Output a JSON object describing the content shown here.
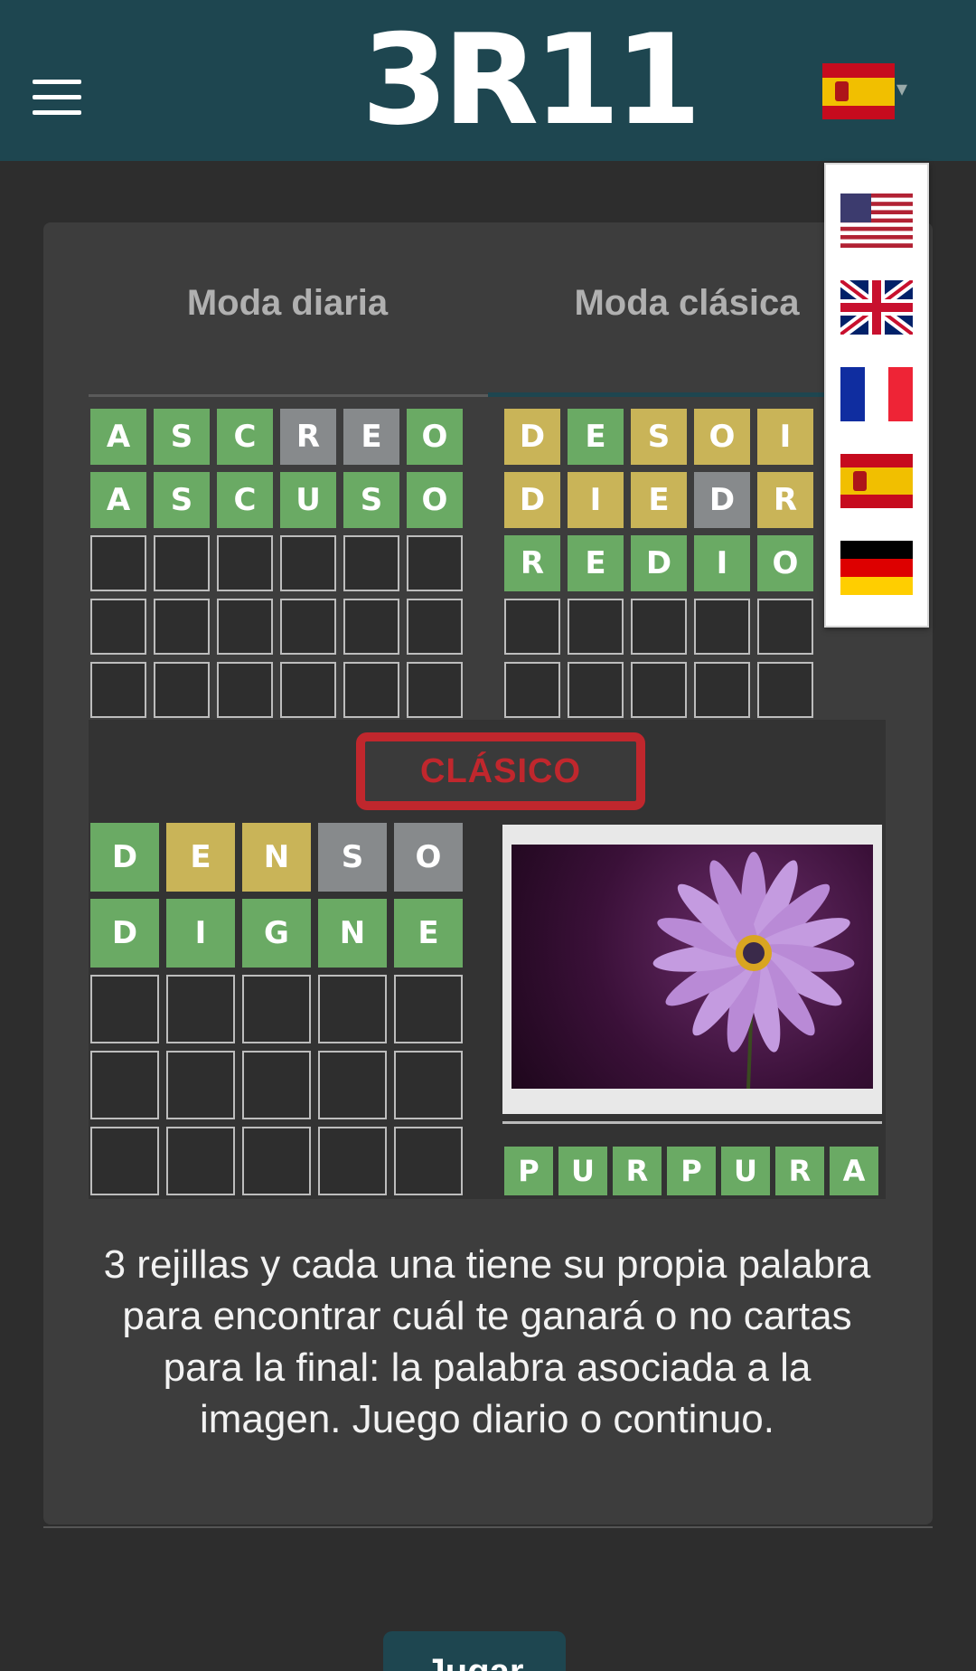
{
  "header": {
    "logo": "3R11",
    "current_language": "es",
    "colors": {
      "header_bg": "#1e4650"
    }
  },
  "tabs": [
    {
      "label": "Moda diaria",
      "active": false
    },
    {
      "label": "Moda clásica",
      "active": true
    }
  ],
  "preview": {
    "grid1_rows": [
      [
        "A",
        "S",
        "C",
        "R",
        "E",
        "O"
      ],
      [
        "A",
        "S",
        "C",
        "U",
        "S",
        "O"
      ]
    ],
    "grid2_rows": [
      [
        "D",
        "E",
        "S",
        "O",
        "I",
        ""
      ],
      [
        "D",
        "I",
        "E",
        "D",
        "R",
        ""
      ],
      [
        "R",
        "E",
        "D",
        "I",
        "O",
        ""
      ]
    ],
    "stamp": "CLÁSICO",
    "grid3_rows": [
      [
        "D",
        "E",
        "N",
        "S",
        "O"
      ],
      [
        "D",
        "I",
        "G",
        "N",
        "E"
      ]
    ],
    "image_word": [
      "P",
      "U",
      "R",
      "P",
      "U",
      "R",
      "A"
    ],
    "colors": {
      "green": "#6aaa64",
      "yellow": "#c9b458",
      "gray": "#878a8c"
    }
  },
  "description": "3 rejillas y cada una tiene su propia palabra para encontrar cuál te ganará o no cartas para la final: la palabra asociada a la imagen. Juego diario o continuo.",
  "play_button": "Jugar",
  "language_menu": [
    {
      "code": "en-us",
      "icon": "us-flag-icon"
    },
    {
      "code": "en-gb",
      "icon": "uk-flag-icon"
    },
    {
      "code": "fr",
      "icon": "fr-flag-icon"
    },
    {
      "code": "es",
      "icon": "es-flag-icon"
    },
    {
      "code": "de",
      "icon": "de-flag-icon"
    }
  ]
}
